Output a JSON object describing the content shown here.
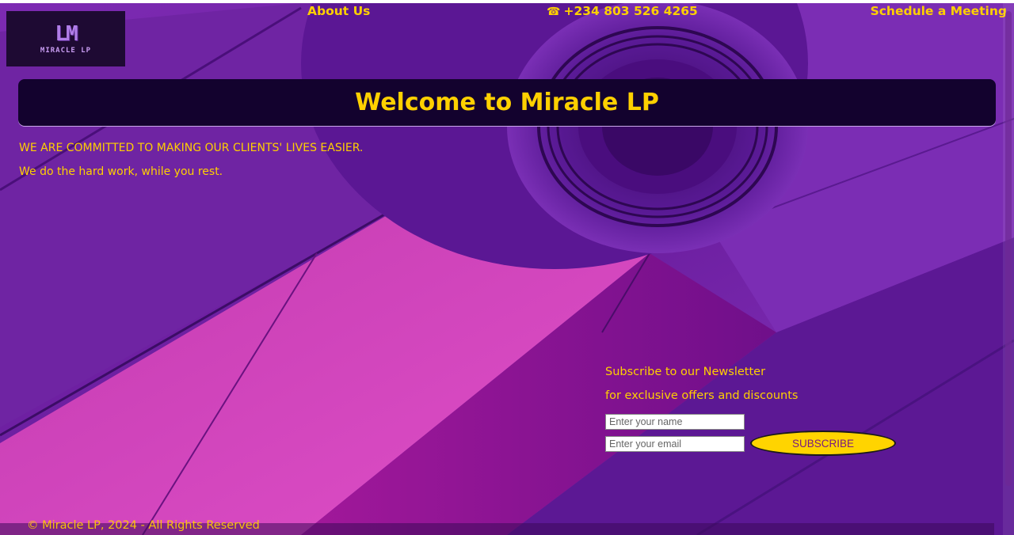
{
  "header": {
    "logo": {
      "mark": "LM",
      "name": "MIRACLE LP"
    },
    "about_label": "About Us",
    "phone_icon": "phone-icon",
    "phone_label": "+234 803 526 4265",
    "meeting_label": "Schedule a Meeting"
  },
  "banner": {
    "title": "Welcome to Miracle LP"
  },
  "hero": {
    "line1": "WE ARE COMMITTED TO MAKING OUR CLIENTS' LIVES EASIER.",
    "line2": "We do the hard work, while you rest."
  },
  "newsletter": {
    "title": "Subscribe to our Newsletter",
    "subtitle": "for exclusive offers and discounts",
    "name_placeholder": "Enter your name",
    "email_placeholder": "Enter your email",
    "button_label": "SUBSCRIBE"
  },
  "footer": {
    "copyright": "© Miracle LP, 2024 - All Rights Reserved"
  },
  "colors": {
    "accent": "#ffd000",
    "background": "#6a1f9c",
    "banner": "#13022e"
  }
}
